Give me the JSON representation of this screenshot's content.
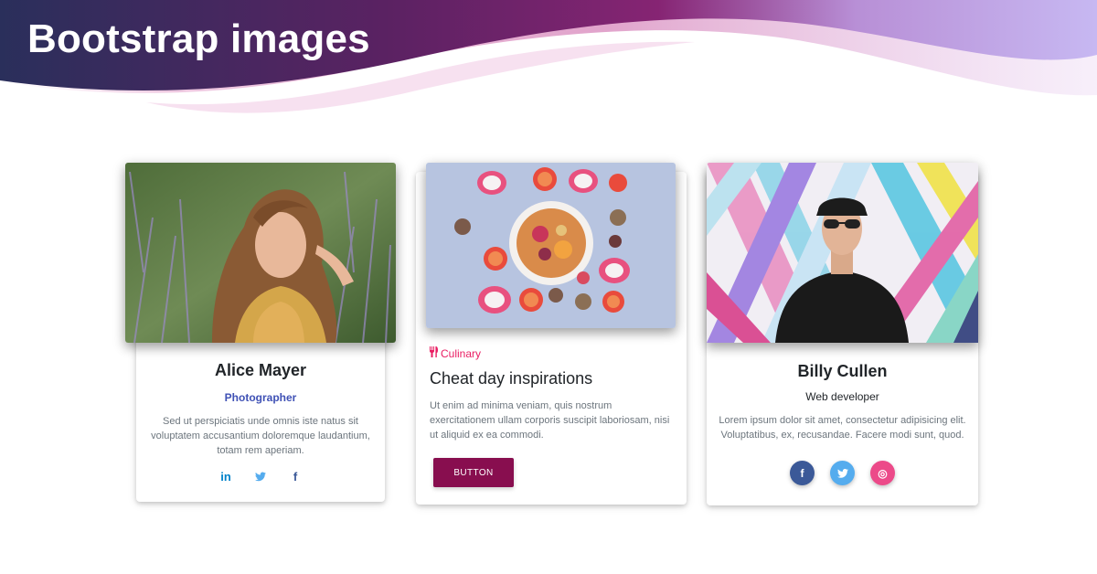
{
  "page": {
    "title": "Bootstrap images"
  },
  "cards": [
    {
      "name": "Alice Mayer",
      "role": "Photographer",
      "text": "Sed ut perspiciatis unde omnis iste natus sit voluptatem accusantium doloremque laudantium, totam rem aperiam.",
      "social": [
        {
          "icon": "linkedin-icon",
          "glyph": "in",
          "color": "#0082ca"
        },
        {
          "icon": "twitter-icon",
          "glyph": "🐦",
          "color": "#55acee"
        },
        {
          "icon": "facebook-icon",
          "glyph": "f",
          "color": "#3b5998"
        }
      ]
    },
    {
      "category": "Culinary",
      "category_icon": "utensils-icon",
      "title": "Cheat day inspirations",
      "text": "Ut enim ad minima veniam, quis nostrum exercitationem ullam corporis suscipit laboriosam, nisi ut aliquid ex ea commodi.",
      "button": "BUTTON"
    },
    {
      "name": "Billy Cullen",
      "role": "Web developer",
      "text": "Lorem ipsum dolor sit amet, consectetur adipisicing elit. Voluptatibus, ex, recusandae. Facere modi sunt, quod.",
      "social": [
        {
          "icon": "facebook-icon",
          "glyph": "f",
          "color": "#3b5998"
        },
        {
          "icon": "twitter-icon",
          "glyph": "t",
          "color": "#55acee"
        },
        {
          "icon": "dribbble-icon",
          "glyph": "◎",
          "color": "#ec4a89"
        }
      ]
    }
  ],
  "colors": {
    "accent": "#880e4f",
    "category": "#e91e63",
    "role_link": "#3f51b5",
    "wave_dark": "#2a2f5b",
    "wave_purple": "#7a1f6e",
    "wave_light": "#c3b3f1"
  }
}
